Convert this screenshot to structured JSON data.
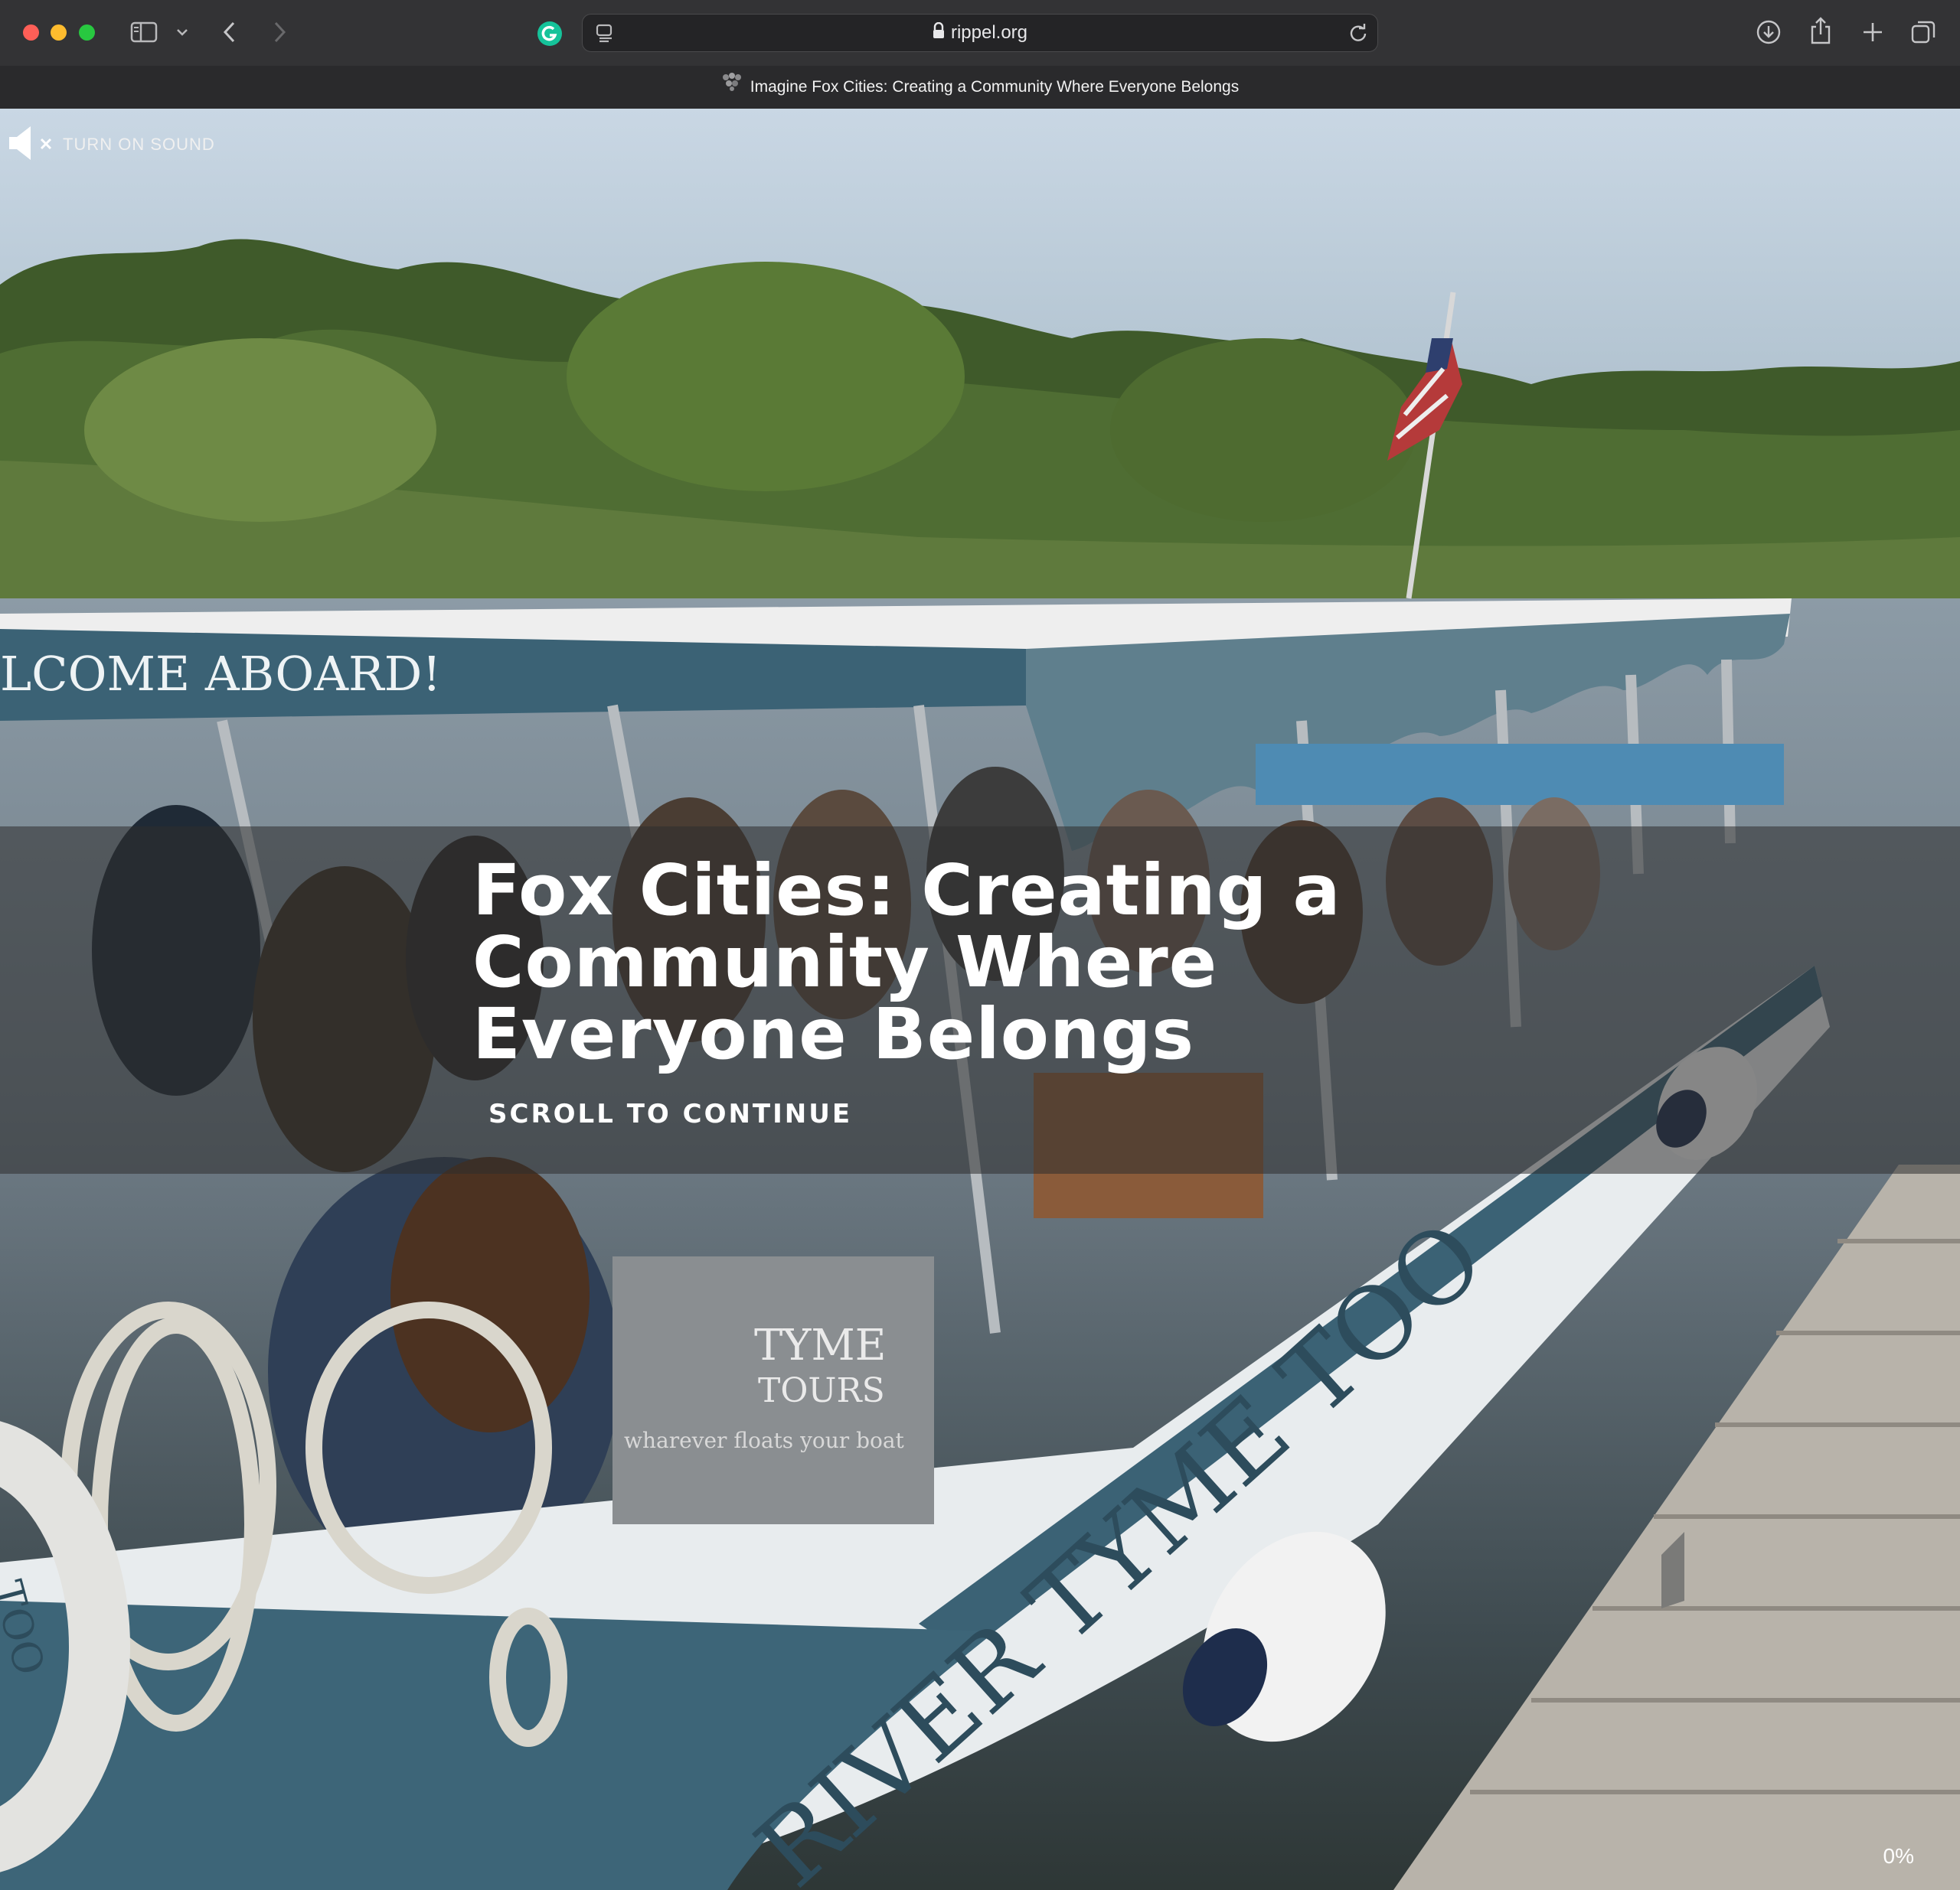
{
  "browser": {
    "url": "rippel.org",
    "tab_title": "Imagine Fox Cities: Creating a Community Where Everyone Belongs"
  },
  "hero": {
    "sound_label": "TURN ON SOUND",
    "title_lines": [
      "Fox Cities: Creating a",
      "Community Where",
      "Everyone Belongs"
    ],
    "scroll_label": "SCROLL TO CONTINUE",
    "progress": "0%",
    "boat_sign": "LCOME ABOARD!",
    "boat_name": "RIVER TYME TOO",
    "boat_panel_line1": "TYME",
    "boat_panel_line2": "TOURS",
    "boat_panel_line3": "wharever floats your boat",
    "ring_text": "TOO"
  },
  "colors": {
    "chrome_bg": "#333335",
    "band_overlay": "rgba(45,45,45,0.55)",
    "boat_blue": "#3b6275"
  },
  "icons": [
    "sidebar-icon",
    "chevron-down-icon",
    "back-icon",
    "forward-icon",
    "grammarly-icon",
    "reader-icon",
    "lock-icon",
    "reload-icon",
    "download-icon",
    "share-icon",
    "new-tab-icon",
    "tabs-overview-icon",
    "speaker-muted-icon"
  ]
}
